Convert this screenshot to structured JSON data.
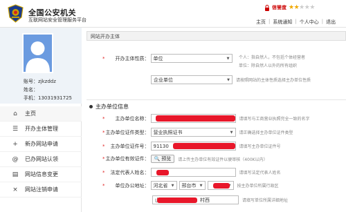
{
  "header": {
    "brand_title": "全国公安机关",
    "brand_subtitle": "互联网站安全管理服务平台",
    "credit_label": "信誉度",
    "credit_stars": 2,
    "credit_total": 5,
    "nav": [
      "主页",
      "系统通知",
      "个人中心",
      "退出"
    ]
  },
  "profile": {
    "account": "账号：zjkzddz",
    "name": "姓名：",
    "phone": "手机：13031931725"
  },
  "sidebar": {
    "items": [
      {
        "label": "主页",
        "icon": "home-icon",
        "glyph": "⌂"
      },
      {
        "label": "开办主体管理",
        "icon": "list-icon",
        "glyph": "☰"
      },
      {
        "label": "新办网站申请",
        "icon": "plus-icon",
        "glyph": "+"
      },
      {
        "label": "已办网站认领",
        "icon": "at-icon",
        "glyph": "@"
      },
      {
        "label": "网站信息变更",
        "icon": "document-icon",
        "glyph": "▤"
      },
      {
        "label": "网站注销申请",
        "icon": "close-icon",
        "glyph": "×"
      }
    ]
  },
  "main": {
    "panel_title": "网站开办主体",
    "subject_nature_label": "开办主体性质：",
    "subject_nature_value": "单位",
    "subject_nature_hint_1": "个人：指自然人，不包括个体经营者",
    "subject_nature_hint_2": "单位：除自然人以外的所有组织",
    "subject_type_value": "企业单位",
    "subject_type_hint": "请按照网站的主体性质选择主办单位性质",
    "section_title": "主办单位信息",
    "fields": {
      "org_name_label": "主办单位名称：",
      "org_name_value": "",
      "org_name_hint": "请填写与工商营业执照完全一致的名字",
      "cert_type_label": "主办单位证件类型：",
      "cert_type_value": "营业执照证书",
      "cert_type_hint": "请正确选择主办单位证件类型",
      "cert_no_label": "主办单位证件号：",
      "cert_no_value": "91130",
      "cert_no_hint": "请填写主办单位证件号",
      "cert_file_label": "主办单位有效证件：",
      "cert_file_button": "预览",
      "cert_file_hint": "请上传主办单位有效证件以便审核（400K以内）",
      "legal_rep_label": "法定代表人姓名：",
      "legal_rep_value": "",
      "legal_rep_hint": "请填写法定代表人姓名",
      "address_label": "单位办公地址：",
      "province": "河北省",
      "city": "邢台市",
      "district": "",
      "address_hint": "按主办单位所属行政区",
      "street_value": "山",
      "street_suffix": "村西",
      "street_hint": "请填写单位所属详细地址"
    }
  },
  "colors": {
    "accent": "#5b8fd8",
    "redaction": "#e8172a",
    "required": "#e02020",
    "star": "#f0a800"
  }
}
